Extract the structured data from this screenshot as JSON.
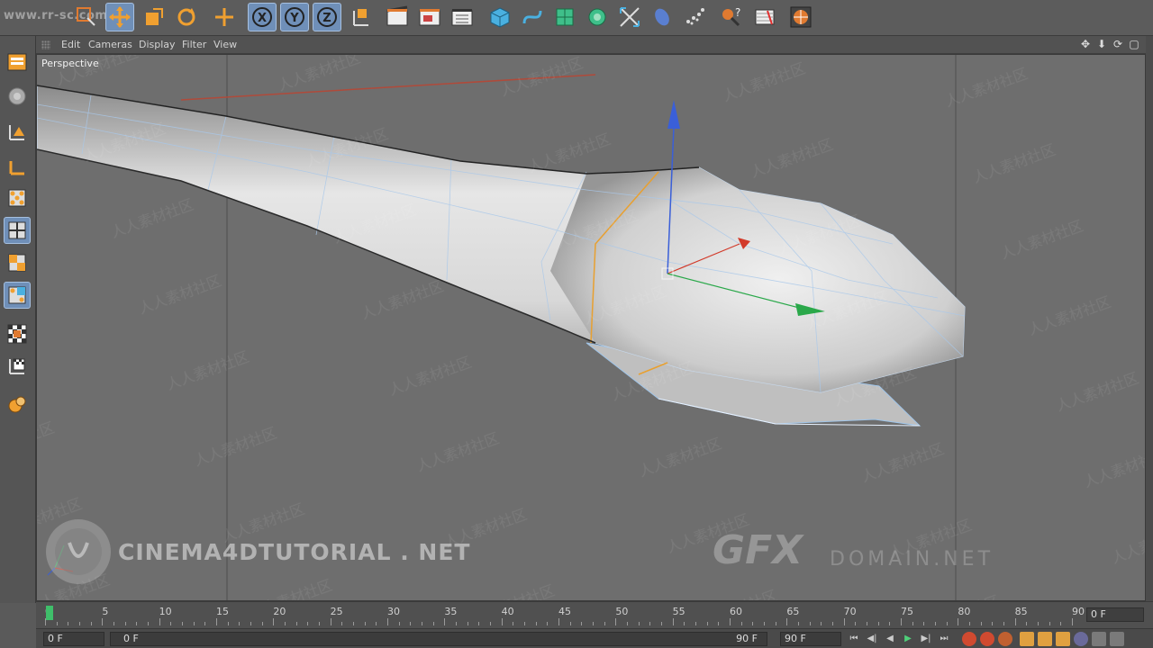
{
  "top_url": "www.rr-sc.com",
  "toolbar": {
    "tools": [
      {
        "name": "undo-icon"
      },
      {
        "name": "live-selection-icon"
      },
      {
        "name": "move-icon"
      },
      {
        "name": "scale-icon"
      },
      {
        "name": "rotate-icon"
      },
      {
        "name": "add-icon"
      },
      {
        "name": "x-axis-lock-icon",
        "label": "X"
      },
      {
        "name": "y-axis-lock-icon",
        "label": "Y"
      },
      {
        "name": "z-axis-lock-icon",
        "label": "Z"
      },
      {
        "name": "coordinate-system-icon"
      },
      {
        "name": "render-view-icon"
      },
      {
        "name": "render-picture-viewer-icon"
      },
      {
        "name": "render-settings-icon"
      },
      {
        "name": "cube-primitive-icon"
      },
      {
        "name": "spline-pen-icon"
      },
      {
        "name": "subdivision-surface-icon"
      },
      {
        "name": "array-icon"
      },
      {
        "name": "deformer-icon"
      },
      {
        "name": "scene-environment-icon"
      },
      {
        "name": "mograph-icon"
      },
      {
        "name": "camera-icon"
      },
      {
        "name": "light-icon"
      },
      {
        "name": "sphere-icon"
      }
    ]
  },
  "left_tools": [
    {
      "name": "make-editable-icon"
    },
    {
      "name": "texture-mode-icon"
    },
    {
      "name": "model-mode-icon"
    },
    {
      "name": "axis-mode-icon"
    },
    {
      "name": "points-mode-icon"
    },
    {
      "name": "edges-mode-icon"
    },
    {
      "name": "polygons-mode-icon"
    },
    {
      "name": "uv-points-mode-icon"
    },
    {
      "name": "enable-axis-icon"
    },
    {
      "name": "tweak-mode-icon"
    },
    {
      "name": "snapping-icon"
    },
    {
      "name": "workplane-icon"
    },
    {
      "name": "locked-workplane-icon"
    }
  ],
  "viewport_menu": {
    "items": [
      "Edit",
      "Cameras",
      "Display",
      "Filter",
      "View"
    ]
  },
  "viewport": {
    "label": "Perspective",
    "watermark_text": "CINEMA4DTUTORIAL . NET",
    "watermark_gfx": "GFX",
    "watermark_domain": "DOMAIN.NET"
  },
  "timeline": {
    "ticks": [
      "0",
      "5",
      "10",
      "15",
      "20",
      "25",
      "30",
      "35",
      "40",
      "45",
      "50",
      "55",
      "60",
      "65",
      "70",
      "75",
      "80",
      "85",
      "90"
    ],
    "current_frame_field": "0 F",
    "playhead_frame": 0
  },
  "transport": {
    "start_field": "0 F",
    "range_start": "0 F",
    "range_end": "90 F",
    "end_field": "90 F"
  },
  "colors": {
    "accent": "#6f8fb8",
    "axis_x": "#d23a2a",
    "axis_y": "#3a5fd8",
    "axis_z": "#2aa84a",
    "playhead": "#3fbf6a"
  }
}
